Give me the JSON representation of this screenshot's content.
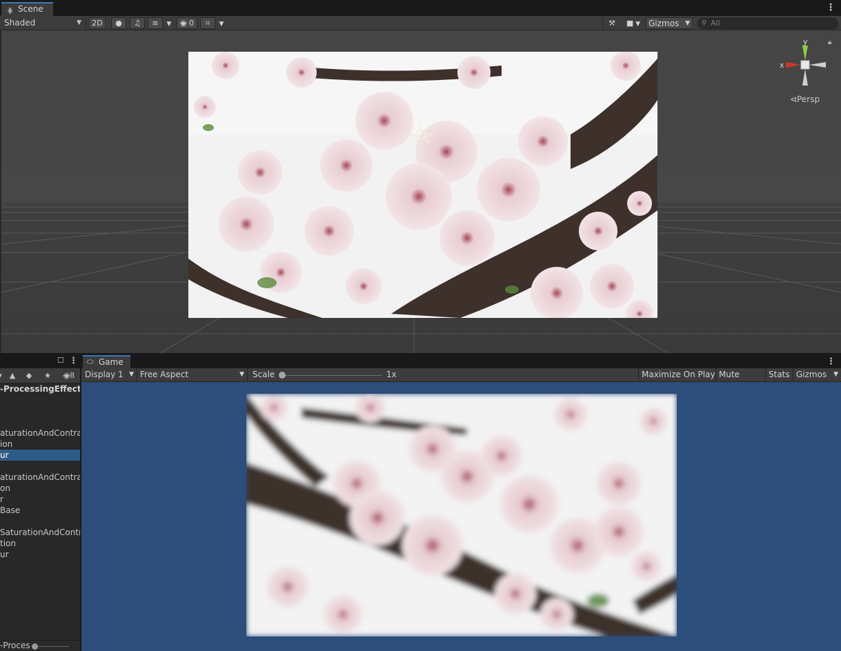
{
  "scene": {
    "tab_label": "Scene",
    "shading_mode": "Shaded",
    "mode_2d": "2D",
    "hidden_count": "0",
    "gizmos_label": "Gizmos",
    "search_placeholder": "All",
    "axis_y": "y",
    "axis_x": "x",
    "projection_label": "Persp"
  },
  "hierarchy": {
    "hidden_count": "8",
    "items": [
      {
        "label": "-ProcessingEffects",
        "kind": "root"
      },
      {
        "label": ""
      },
      {
        "label": ""
      },
      {
        "label": ""
      },
      {
        "label": "aturationAndContras"
      },
      {
        "label": "ion"
      },
      {
        "label": "ur",
        "selected": true
      },
      {
        "label": ""
      },
      {
        "label": "aturationAndContrast"
      },
      {
        "label": "on"
      },
      {
        "label": "r"
      },
      {
        "label": "Base"
      },
      {
        "label": ""
      },
      {
        "label": "SaturationAndContras"
      },
      {
        "label": "tion"
      },
      {
        "label": "ur"
      }
    ],
    "bottom_label": "-Proces"
  },
  "game": {
    "tab_label": "Game",
    "display": "Display 1",
    "aspect": "Free Aspect",
    "scale_label": "Scale",
    "scale_value": "1x",
    "scale_fraction": 0.0,
    "maximize_on_play": "Maximize On Play",
    "mute_audio": "Mute Audio",
    "stats": "Stats",
    "gizmos": "Gizmos"
  },
  "colors": {
    "accent_tab": "#3a79bb",
    "selection": "#2c5d87",
    "game_background": "#2d4d7a",
    "axis_x": "#d8341f",
    "axis_y": "#8cd13d"
  },
  "icons": [
    "grid-icon",
    "lightbulb-icon",
    "audio-icon",
    "effects-icon",
    "visibility-icon",
    "grid-snap-icon",
    "tools-icon",
    "camera-icon",
    "search-icon",
    "lock-icon",
    "gamepad-icon",
    "sun-icon"
  ]
}
